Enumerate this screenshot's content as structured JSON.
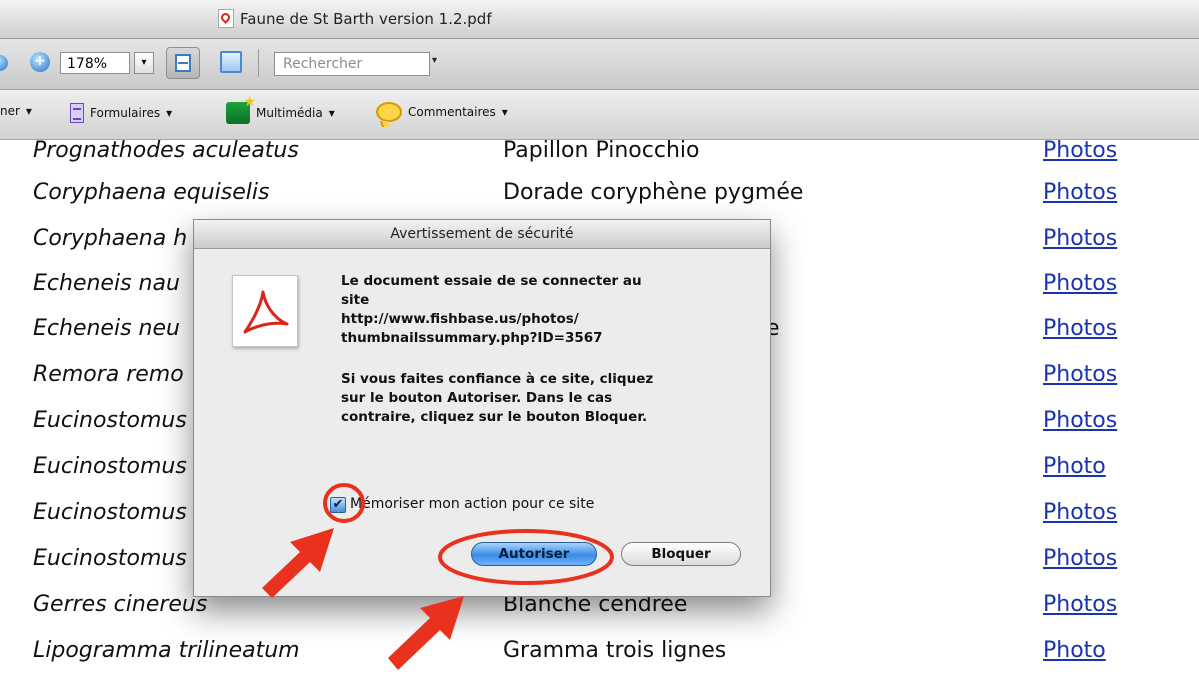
{
  "window": {
    "title": "Faune de St Barth version 1.2.pdf"
  },
  "toolbar": {
    "zoom_value": "178%",
    "zoom_dropdown": "▾",
    "search_placeholder": "Rechercher",
    "search_dropdown": "▾"
  },
  "toolbar2": {
    "partial_item": "ner",
    "forms": "Formulaires",
    "multimedia": "Multimédia",
    "comments": "Commentaires",
    "dropdown": "▾"
  },
  "document": {
    "rows": [
      {
        "latin": "Prognathodes aculeatus",
        "common": "Papillon Pinocchio",
        "link": "Photos"
      },
      {
        "latin": "Coryphaena equiselis",
        "common": "Dorade coryphène pygmée",
        "link": "Photos"
      },
      {
        "latin": "Coryphaena h",
        "common": "",
        "link": "Photos"
      },
      {
        "latin": "Echeneis nau",
        "common": "",
        "link": "Photos"
      },
      {
        "latin": "Echeneis neu",
        "common": "e",
        "link": "Photos"
      },
      {
        "latin": "Remora remo",
        "common": "",
        "link": "Photos"
      },
      {
        "latin": "Eucinostomus",
        "common": "",
        "link": "Photos"
      },
      {
        "latin": "Eucinostomus",
        "common": "",
        "link": "Photo"
      },
      {
        "latin": "Eucinostomus",
        "common": "",
        "link": "Photos"
      },
      {
        "latin": "Eucinostomus",
        "common": "",
        "link": "Photos"
      },
      {
        "latin": "Gerres cinereus",
        "common": "Blanche cendrée",
        "link": "Photos"
      },
      {
        "latin": "Lipogramma trilineatum",
        "common": "Gramma trois lignes",
        "link": "Photo"
      }
    ]
  },
  "dialog": {
    "title": "Avertissement de sécurité",
    "message": "Le document essaie de se connecter au\nsite\nhttp://www.fishbase.us/photos/\nthumbnailssummary.php?ID=3567",
    "instruction": "Si vous faites confiance à ce site, cliquez\nsur le bouton Autoriser. Dans le cas\ncontraire, cliquez sur le bouton Bloquer.",
    "checkbox_mark": "✔",
    "checkbox_label": "Mémoriser mon action pour ce site",
    "allow_label": "Autoriser",
    "block_label": "Bloquer"
  },
  "colors": {
    "link": "#1a33b0",
    "annotation": "#e8321e",
    "allow_button": "#3b8be3"
  },
  "icons": {
    "title_icon": "pdf-doc-icon",
    "zoom_out": "zoom-out-icon",
    "zoom_in": "zoom-in-icon",
    "fit_width": "fit-width-icon",
    "fullscreen": "fullscreen-icon",
    "forms": "form-icon",
    "multimedia": "multimedia-icon",
    "comments": "comment-icon",
    "dialog": "acrobat-icon"
  }
}
